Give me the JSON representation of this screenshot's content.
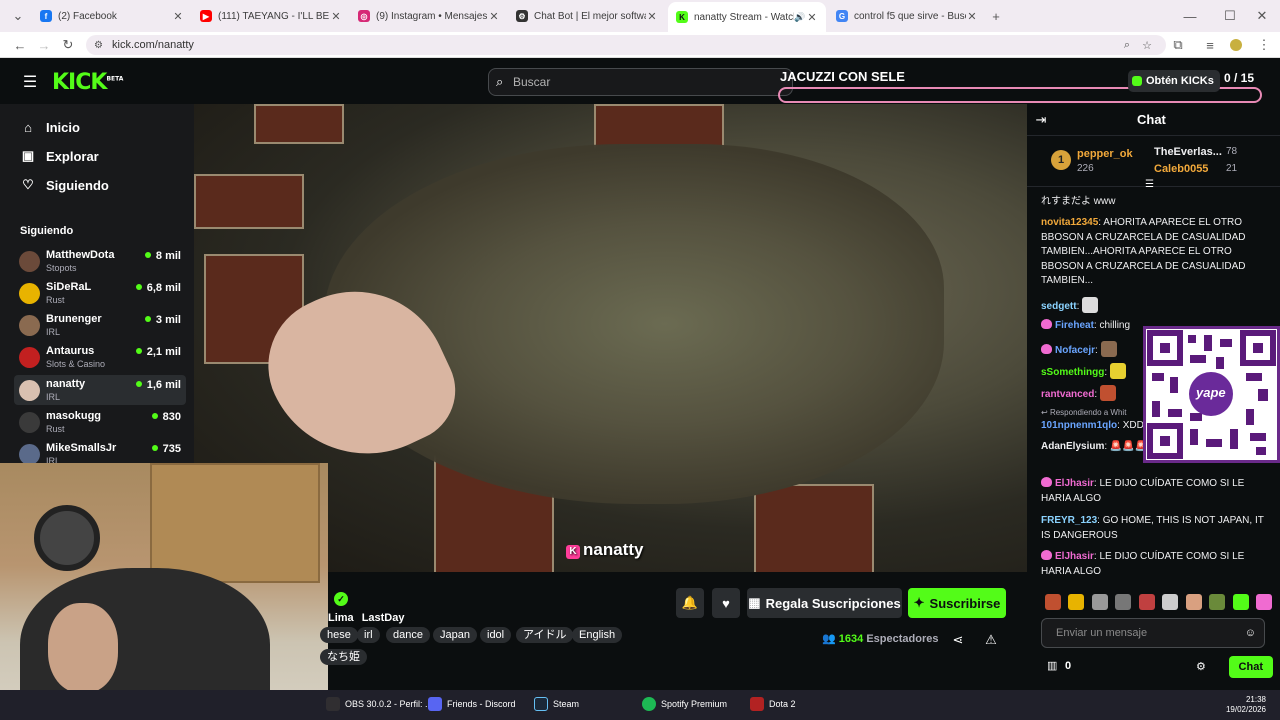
{
  "browser": {
    "tabs": [
      {
        "title": "(2) Facebook",
        "fav_color": "#1877f2",
        "fav_glyph": "f"
      },
      {
        "title": "(111) TAEYANG - I'LL BE THERE",
        "fav_color": "#ff0000",
        "fav_glyph": "▶"
      },
      {
        "title": "(9) Instagram • Mensajes",
        "fav_color": "#d62976",
        "fav_glyph": "◎"
      },
      {
        "title": "Chat Bot | El mejor software pa",
        "fav_color": "#333333",
        "fav_glyph": "⚙"
      },
      {
        "title": "nanatty Stream - Watch Live",
        "fav_color": "#53fc18",
        "fav_glyph": "K"
      },
      {
        "title": "control f5 que sirve - Buscar co",
        "fav_color": "#4285f4",
        "fav_glyph": "G"
      }
    ],
    "url": "kick.com/nanatty"
  },
  "header": {
    "search_placeholder": "Buscar",
    "overlay_title": "JACUZZI CON SELE",
    "get_kicks": "Obtén KICKs",
    "counter": "0 / 15"
  },
  "sidebar": {
    "nav": [
      {
        "label": "Inicio",
        "icon": "home-icon",
        "glyph": "⌂"
      },
      {
        "label": "Explorar",
        "icon": "compass-icon",
        "glyph": "▣"
      },
      {
        "label": "Siguiendo",
        "icon": "heart-icon",
        "glyph": "♡"
      }
    ],
    "following_title": "Siguiendo",
    "channels": [
      {
        "name": "MatthewDota",
        "category": "Stopots",
        "viewers": "8 mil",
        "color": "#6b4a3a"
      },
      {
        "name": "SiDeRaL",
        "category": "Rust",
        "viewers": "6,8 mil",
        "color": "#e8b300"
      },
      {
        "name": "Brunenger",
        "category": "IRL",
        "viewers": "3 mil",
        "color": "#8a6a50"
      },
      {
        "name": "Antaurus",
        "category": "Slots & Casino",
        "viewers": "2,1 mil",
        "color": "#c22020"
      },
      {
        "name": "nanatty",
        "category": "IRL",
        "viewers": "1,6 mil",
        "color": "#d9c0b0"
      },
      {
        "name": "masokugg",
        "category": "Rust",
        "viewers": "830",
        "color": "#3a3a3a"
      },
      {
        "name": "MikeSmallsJr",
        "category": "IRL",
        "viewers": "735",
        "color": "#5a6a8a"
      }
    ]
  },
  "video": {
    "watermark": "nanatty"
  },
  "stream_info": {
    "verified_mark": "✓",
    "subtitle": [
      "Lima",
      "LastDay"
    ],
    "tags_row1": [
      "hese",
      "irl",
      "dance",
      "Japan",
      "idol",
      "アイドル",
      "English"
    ],
    "tags_row2": [
      "なち姫"
    ],
    "gift_label": "Regala Suscripciones",
    "subscribe_label": "Suscribirse",
    "viewers_count": "1634",
    "viewers_label": "Espectadores"
  },
  "chat": {
    "title": "Chat",
    "leaders": [
      {
        "rank": "1",
        "name": "pepper_ok",
        "amount": "226"
      },
      {
        "name": "TheEverlas...",
        "amount": "78"
      },
      {
        "name": "Caleb0055",
        "amount": "21"
      }
    ],
    "messages": [
      {
        "user": "",
        "text": "れすまだよ www",
        "color": "#efeff1"
      },
      {
        "user": "novita12345",
        "text": ": AHORITA APARECE EL OTRO BBOSON A CRUZARCELA DE CASUALIDAD TAMBIEN...AHORITA APARECE EL OTRO BBOSON A CRUZARCELA DE CASUALIDAD TAMBIEN...",
        "color": "#f2a93b"
      },
      {
        "user": "sedgett",
        "text": ":",
        "color": "#8bd3ff"
      },
      {
        "user": "Fireheat",
        "text": ": chilling",
        "color": "#6aa5ff"
      },
      {
        "user": "Nofacejr",
        "text": ":",
        "color": "#6aa5ff"
      },
      {
        "user": "sSomethingg",
        "text": ":",
        "color": "#53fc18"
      },
      {
        "user": "rantvanced",
        "text": ":",
        "color": "#f06bd1"
      },
      {
        "user": "101npnenm1qlo",
        "text": ": XDDD",
        "color": "#6aa5ff"
      },
      {
        "user": "AdanElysium",
        "text": ": 🚨🚨🚨 POLICE POLICE 🚨🚨🚨",
        "color": "#efeff1"
      },
      {
        "user": "ElJhasir",
        "text": ": LE DIJO CUÍDATE COMO SI LE HARIA ALGO",
        "color": "#f06bd1"
      },
      {
        "user": "FREYR_123",
        "text": ": GO HOME, THIS IS NOT JAPAN, IT IS DANGEROUS",
        "color": "#8bd3ff"
      },
      {
        "user": "ElJhasir",
        "text": ": LE DIJO CUÍDATE COMO SI LE HARIA ALGO",
        "color": "#f06bd1"
      }
    ],
    "reply_to": "Respondiendo a Whit",
    "qr_label": "yape",
    "input_placeholder": "Enviar un mensaje",
    "points": "0",
    "send_label": "Chat"
  },
  "taskbar": {
    "apps": [
      {
        "label": "OBS 30.0.2 - Perfil: ...",
        "color": "#302e31"
      },
      {
        "label": "Friends - Discord",
        "color": "#5865f2"
      },
      {
        "label": "Steam",
        "color": "#1b2838"
      },
      {
        "label": "Spotify Premium",
        "color": "#1db954"
      },
      {
        "label": "Dota 2",
        "color": "#b22222"
      }
    ],
    "time": "21:38",
    "date": "19/02/2026"
  }
}
